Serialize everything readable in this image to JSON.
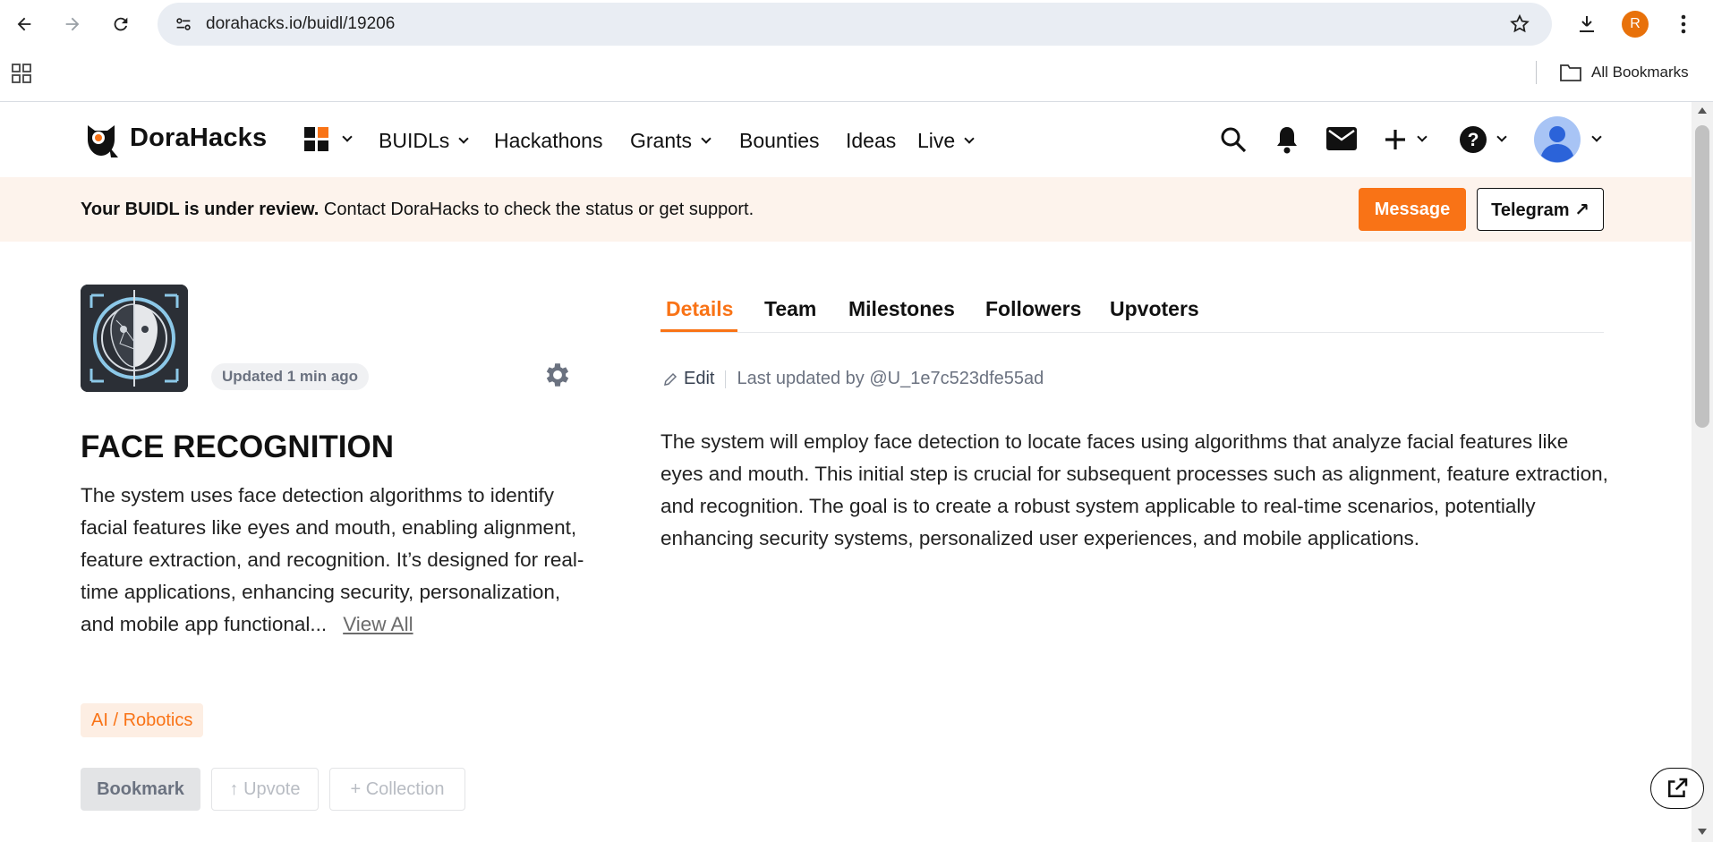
{
  "browser": {
    "url": "dorahacks.io/buidl/19206",
    "all_bookmarks_label": "All Bookmarks",
    "profile_initial": "R"
  },
  "header": {
    "logo_text": "DoraHacks",
    "nav": [
      {
        "label": "BUIDLs",
        "has_dropdown": true
      },
      {
        "label": "Hackathons",
        "has_dropdown": false
      },
      {
        "label": "Grants",
        "has_dropdown": true
      },
      {
        "label": "Bounties",
        "has_dropdown": false
      },
      {
        "label": "Ideas",
        "has_dropdown": false
      },
      {
        "label": "Live",
        "has_dropdown": true
      }
    ]
  },
  "banner": {
    "bold_text": "Your BUIDL is under review.",
    "text": " Contact DoraHacks to check the status or get support.",
    "message_button": "Message",
    "telegram_button": "Telegram ↗"
  },
  "project": {
    "updated": "Updated 1 min ago",
    "title": "FACE RECOGNITION",
    "description": "The system uses face detection algorithms to identify facial features like eyes and mouth, enabling alignment, feature extraction, and recognition. It’s designed for real-time applications, enhancing security, personalization, and mobile app functional...",
    "view_all": "View All",
    "tag": "AI / Robotics",
    "actions": {
      "bookmark": "Bookmark",
      "upvote": "↑ Upvote",
      "collection": "+ Collection"
    }
  },
  "tabs": [
    "Details",
    "Team",
    "Milestones",
    "Followers",
    "Upvoters"
  ],
  "details": {
    "edit_label": "Edit",
    "last_updated": "Last updated by @U_1e7c523dfe55ad",
    "body": "The system will employ face detection to locate faces using algorithms that analyze facial features like eyes and mouth. This initial step is crucial for subsequent processes such as alignment, feature extraction, and recognition. The goal is to create a robust system applicable to real-time scenarios, potentially enhancing security systems, personalized user experiences, and mobile applications."
  },
  "colors": {
    "accent": "#f97316",
    "banner_bg": "#fdf3ec",
    "tag_bg": "#fdeee3"
  }
}
